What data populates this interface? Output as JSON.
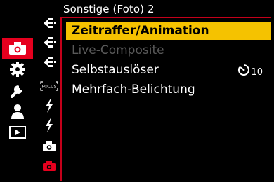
{
  "header": {
    "title": "Sonstige (Foto) 2"
  },
  "main_menu": [
    {
      "icon": "camera-icon",
      "active": true
    },
    {
      "icon": "gear-icon",
      "active": false
    },
    {
      "icon": "wrench-icon",
      "active": false
    },
    {
      "icon": "person-icon",
      "active": false
    },
    {
      "icon": "playback-icon",
      "active": false
    }
  ],
  "sub_menu": [
    {
      "icon": "arrows-icon"
    },
    {
      "icon": "arrows-icon"
    },
    {
      "icon": "arrows-icon"
    },
    {
      "icon": "focus-icon",
      "label": "FOCUS"
    },
    {
      "icon": "flash-icon"
    },
    {
      "icon": "flash-icon"
    },
    {
      "icon": "camera-small-icon"
    },
    {
      "icon": "camera-small-active-icon"
    }
  ],
  "items": [
    {
      "label": "Zeitraffer/Animation",
      "state": "selected"
    },
    {
      "label": "Live-Composite",
      "state": "disabled"
    },
    {
      "label": "Selbstauslöser",
      "state": "normal",
      "value": "10",
      "value_icon": "self-timer-icon"
    },
    {
      "label": "Mehrfach-Belichtung",
      "state": "normal"
    }
  ],
  "colors": {
    "accent": "#e6001e",
    "highlight": "#f5c200",
    "disabled_text": "#5a5a5a",
    "divider": "#c4001a"
  }
}
